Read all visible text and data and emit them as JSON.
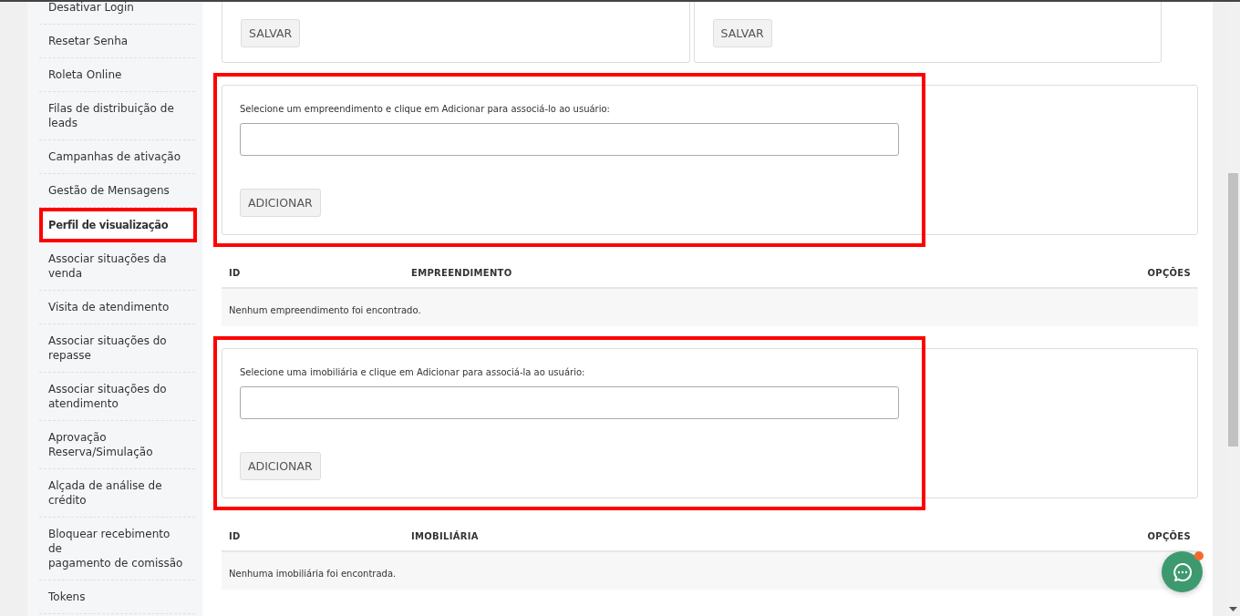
{
  "sidebar": {
    "items": [
      {
        "label": "Desativar Login",
        "selected": false
      },
      {
        "label": "Resetar Senha",
        "selected": false
      },
      {
        "label": "Roleta Online",
        "selected": false
      },
      {
        "label": "Filas de distribuição de leads",
        "selected": false
      },
      {
        "label": "Campanhas de ativação",
        "selected": false
      },
      {
        "label": "Gestão de Mensagens",
        "selected": false
      },
      {
        "label": "Perfil de visualização",
        "selected": true
      },
      {
        "label": "Associar situações da venda",
        "selected": false
      },
      {
        "label": "Visita de atendimento",
        "selected": false
      },
      {
        "label": "Associar situações do repasse",
        "selected": false
      },
      {
        "label": "Associar situações do atendimento",
        "selected": false
      },
      {
        "label": "Aprovação Reserva/Simulação",
        "selected": false
      },
      {
        "label": "Alçada de análise de crédito",
        "selected": false
      },
      {
        "label": "Bloquear recebimento\nde\npagamento de comissão",
        "selected": false
      },
      {
        "label": "Tokens",
        "selected": false
      }
    ]
  },
  "top_cards": [
    {
      "button": "SALVAR"
    },
    {
      "button": "SALVAR"
    }
  ],
  "sections": [
    {
      "form": {
        "label": "Selecione um empreendimento e clique em Adicionar para associá-lo ao usuário:",
        "button": "ADICIONAR",
        "highlighted": true
      },
      "table": {
        "columns": [
          "ID",
          "EMPREENDIMENTO",
          "OPÇÕES"
        ],
        "empty_message": "Nenhum empreendimento foi encontrado."
      }
    },
    {
      "form": {
        "label": "Selecione uma imobiliária e clique em Adicionar para associá-la ao usuário:",
        "button": "ADICIONAR",
        "highlighted": true
      },
      "table": {
        "columns": [
          "ID",
          "IMOBILIÁRIA",
          "OPÇÕES"
        ],
        "empty_message": "Nenhuma imobiliária foi encontrada."
      }
    }
  ],
  "chat": {
    "unread": true
  }
}
